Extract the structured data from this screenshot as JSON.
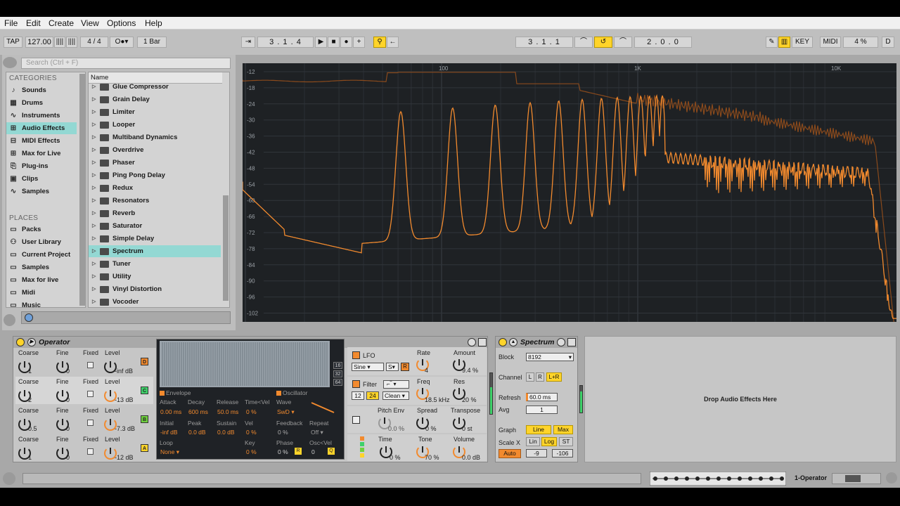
{
  "menu": [
    "File",
    "Edit",
    "Create",
    "View",
    "Options",
    "Help"
  ],
  "transport": {
    "tap": "TAP",
    "bpm": "127.00",
    "signature": "4 / 4",
    "quantize": "1 Bar",
    "position": "3 .  1 .  4",
    "loop_start": "3 .  1 .  1",
    "loop_length": "2 .  0 .  0",
    "key": "KEY",
    "midi": "MIDI",
    "cpu": "4 %",
    "d": "D"
  },
  "browser": {
    "search_placeholder": "Search (Ctrl + F)",
    "categories_header": "CATEGORIES",
    "places_header": "PLACES",
    "name_header": "Name",
    "categories": [
      {
        "label": "Sounds",
        "icon": "♪"
      },
      {
        "label": "Drums",
        "icon": "▦"
      },
      {
        "label": "Instruments",
        "icon": "∿"
      },
      {
        "label": "Audio Effects",
        "icon": "⊞"
      },
      {
        "label": "MIDI Effects",
        "icon": "⊟"
      },
      {
        "label": "Max for Live",
        "icon": "⊞"
      },
      {
        "label": "Plug-ins",
        "icon": "⎘"
      },
      {
        "label": "Clips",
        "icon": "▣"
      },
      {
        "label": "Samples",
        "icon": "∿"
      }
    ],
    "places": [
      "Packs",
      "User Library",
      "Current Project",
      "Samples",
      "Max for live",
      "Midi",
      "Music"
    ],
    "items": [
      "Glue Compressor",
      "Grain Delay",
      "Limiter",
      "Looper",
      "Multiband Dynamics",
      "Overdrive",
      "Phaser",
      "Ping Pong Delay",
      "Redux",
      "Resonators",
      "Reverb",
      "Saturator",
      "Simple Delay",
      "Spectrum",
      "Tuner",
      "Utility",
      "Vinyl Distortion",
      "Vocoder"
    ],
    "selected_item": "Spectrum",
    "selected_category": "Audio Effects"
  },
  "spectrum_view": {
    "db_labels": [
      "-12",
      "-18",
      "-24",
      "-30",
      "-36",
      "-42",
      "-48",
      "-54",
      "-60",
      "-66",
      "-72",
      "-78",
      "-84",
      "-90",
      "-96",
      "-102"
    ],
    "freq_labels": [
      "100",
      "1K",
      "10K"
    ],
    "line_color": "#f28a2e"
  },
  "operator": {
    "title": "Operator",
    "ops": [
      {
        "coarse": "1",
        "fine": "0",
        "level": "-inf dB",
        "letter": "D",
        "color": "#f28a2e"
      },
      {
        "coarse": "2",
        "fine": "0",
        "level": "-13 dB",
        "letter": "C",
        "color": "#3fd16a"
      },
      {
        "coarse": "0.5",
        "fine": "0",
        "level": "-7.3 dB",
        "letter": "B",
        "color": "#6fd13f"
      },
      {
        "coarse": "1",
        "fine": "0",
        "level": "-12 dB",
        "letter": "A",
        "color": "#ffd42a"
      }
    ],
    "labels": {
      "coarse": "Coarse",
      "fine": "Fine",
      "fixed": "Fixed",
      "level": "Level"
    },
    "side_buttons": [
      "16",
      "32",
      "64"
    ],
    "env": {
      "section": "Envelope",
      "attack_l": "Attack",
      "attack": "0.00 ms",
      "decay_l": "Decay",
      "decay": "600 ms",
      "release_l": "Release",
      "release": "50.0 ms",
      "timevel_l": "Time<Vel",
      "timevel": "0 %",
      "initial_l": "Initial",
      "initial": "-inf dB",
      "peak_l": "Peak",
      "peak": "0.0 dB",
      "sustain_l": "Sustain",
      "sustain": "0.0 dB",
      "vel_l": "Vel",
      "vel": "0 %",
      "loop_l": "Loop",
      "loop": "None",
      "key_l": "Key",
      "key": "0 %"
    },
    "osc": {
      "section": "Oscillator",
      "wave_l": "Wave",
      "wave": "SwD",
      "feedback_l": "Feedback",
      "feedback": "0 %",
      "repeat_l": "Repeat",
      "repeat": "Off",
      "phase_l": "Phase",
      "phase": "0 %",
      "oscvel_l": "Osc<Vel",
      "oscvel": "0"
    },
    "lfo": {
      "label": "LFO",
      "wave": "Sine",
      "sync": "S",
      "r": "R",
      "rate_l": "Rate",
      "rate": "4",
      "amount_l": "Amount",
      "amount": "9.4 %"
    },
    "filter": {
      "label": "Filter",
      "db12": "12",
      "db24": "24",
      "mode": "Clean",
      "freq_l": "Freq",
      "freq": "18.5 kHz",
      "res_l": "Res",
      "res": "20 %"
    },
    "pitch": {
      "pitchenv_l": "Pitch Env",
      "pitchenv": "0.0 %",
      "spread_l": "Spread",
      "spread": "0 %",
      "transpose_l": "Transpose",
      "transpose": "0 st"
    },
    "global": {
      "time_l": "Time",
      "time": "0 %",
      "tone_l": "Tone",
      "tone": "70 %",
      "volume_l": "Volume",
      "volume": "0.0 dB"
    }
  },
  "spectrum_device": {
    "title": "Spectrum",
    "block_l": "Block",
    "block": "8192",
    "channel_l": "Channel",
    "ch_l": "L",
    "ch_r": "R",
    "ch_lr": "L+R",
    "refresh_l": "Refresh",
    "refresh": "60.0 ms",
    "avg_l": "Avg",
    "avg": "1",
    "graph_l": "Graph",
    "graph_line": "Line",
    "graph_max": "Max",
    "scalex_l": "Scale X",
    "lin": "Lin",
    "log": "Log",
    "st": "ST",
    "auto": "Auto",
    "range_lo": "-9",
    "range_hi": "-106"
  },
  "drop_text": "Drop Audio Effects Here",
  "track_name": "1-Operator"
}
